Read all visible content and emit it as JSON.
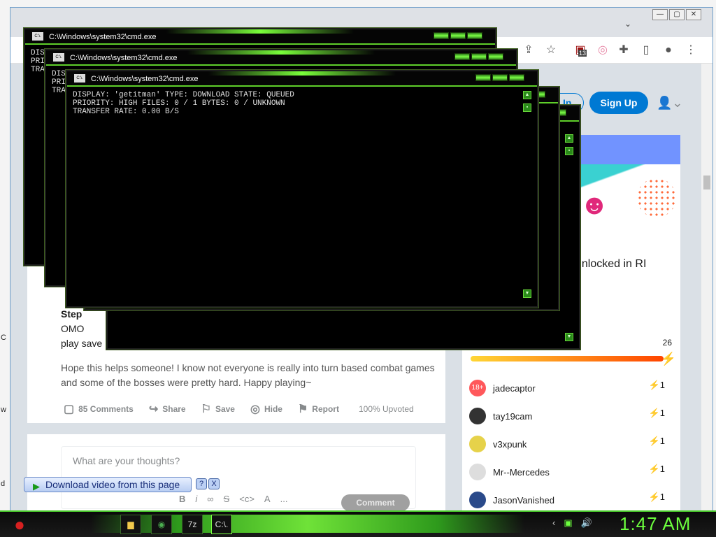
{
  "desktop": {
    "edge_chars": [
      "C",
      "w",
      "d"
    ]
  },
  "browser": {
    "window_buttons": [
      "—",
      "▢",
      "✕"
    ],
    "toolbar_icons": [
      "share-icon",
      "star-icon",
      "extension-badge-icon",
      "puzzle-icon",
      "side-panel-icon",
      "profile-icon",
      "menu-icon"
    ],
    "extension_badge": "13",
    "header": {
      "login_label": "In",
      "signup_label": "Sign Up"
    }
  },
  "post": {
    "step_label": "Step",
    "partial_lines": [
      "OMO",
      "play save"
    ],
    "helps_text": "Hope this helps someone! I know not everyone is really into turn based combat games and some of the bosses were pretty hard. Happy playing~",
    "actions": {
      "comments": "85 Comments",
      "share": "Share",
      "save": "Save",
      "hide": "Hide",
      "report": "Report",
      "upvoted": "100% Upvoted"
    },
    "comment_box": {
      "placeholder": "What are your thoughts?",
      "button": "Comment",
      "toolbar": [
        "B",
        "i",
        "S",
        "<c>",
        "A",
        "..."
      ]
    }
  },
  "sidebar": {
    "banner_title": "unlocked in RI",
    "progress_count": "26",
    "leaders": [
      {
        "name": "jadecaptor",
        "count": "1",
        "avatar": "18+"
      },
      {
        "name": "tay19cam",
        "count": "1",
        "avatar": ""
      },
      {
        "name": "v3xpunk",
        "count": "1",
        "avatar": ""
      },
      {
        "name": "Mr--Mercedes",
        "count": "1",
        "avatar": ""
      },
      {
        "name": "JasonVanished",
        "count": "1",
        "avatar": ""
      }
    ]
  },
  "cmd_windows": {
    "title": "C:\\Windows\\system32\\cmd.exe",
    "icon_text": "C:\\.",
    "partial_lines": [
      "DIS",
      "PRI",
      "TRA"
    ],
    "main_lines": [
      "DISPLAY: 'getitman' TYPE: DOWNLOAD STATE: QUEUED",
      "PRIORITY: HIGH FILES: 0 / 1 BYTES: 0 / UNKNOWN",
      "TRANSFER RATE: 0.00 B/S"
    ]
  },
  "download_bar": {
    "label": "Download video from this page",
    "help": "?",
    "close": "X"
  },
  "taskbar": {
    "apps": [
      "folder-icon",
      "chrome-icon",
      "7z-icon",
      "cmd-icon"
    ],
    "app_labels": [
      "",
      "",
      "7z",
      "C:\\."
    ],
    "clock": "1:47 AM"
  },
  "colors": {
    "accent_green": "#6cff3e",
    "reddit_blue": "#0079d3",
    "progress_orange": "#ff4500"
  }
}
